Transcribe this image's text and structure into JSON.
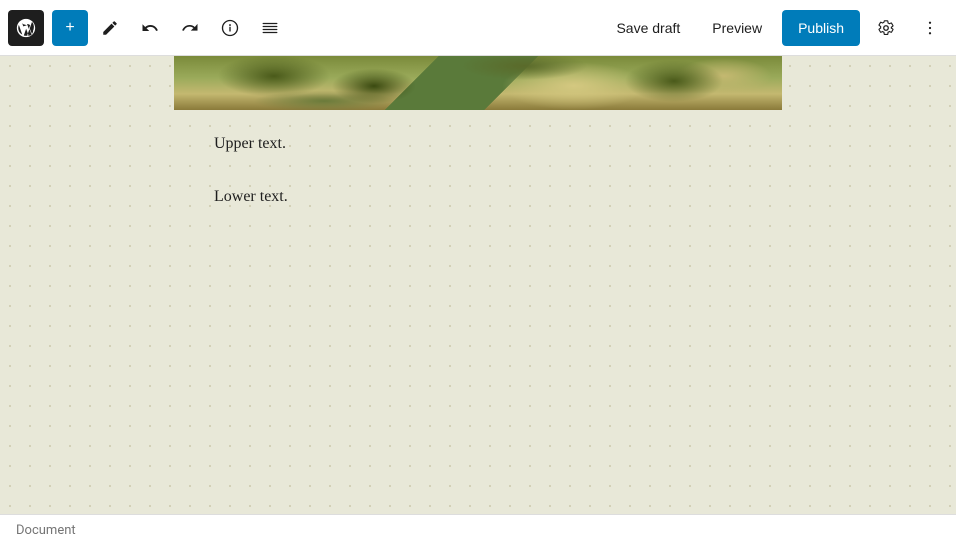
{
  "toolbar": {
    "add_label": "+",
    "save_draft_label": "Save draft",
    "preview_label": "Preview",
    "publish_label": "Publish"
  },
  "editor": {
    "upper_text": "Upper text.",
    "lower_text": "Lower text."
  },
  "status_bar": {
    "document_label": "Document"
  },
  "icons": {
    "pen": "✏",
    "undo": "↩",
    "redo": "↪",
    "info": "ℹ",
    "list": "≡",
    "settings": "⚙",
    "more": "⋮"
  }
}
